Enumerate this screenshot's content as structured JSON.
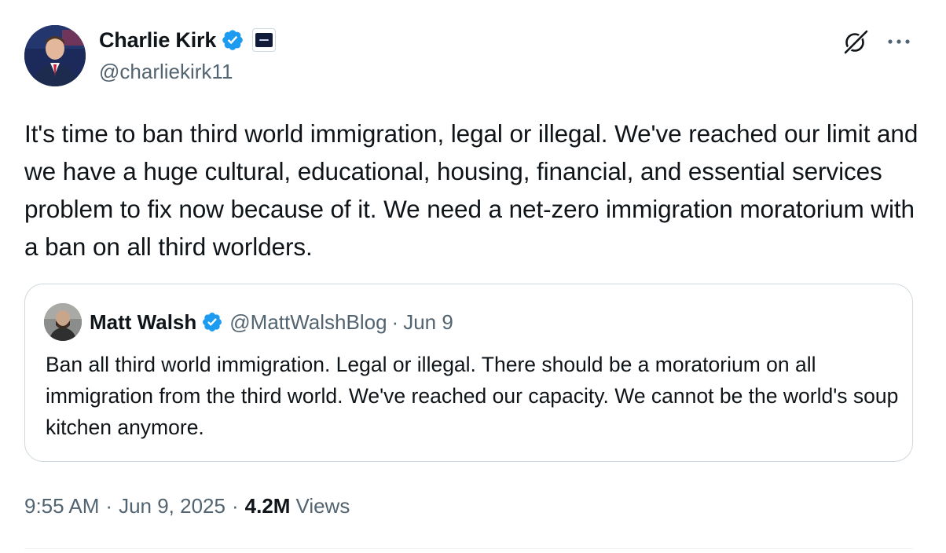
{
  "author": {
    "name": "Charlie Kirk",
    "handle": "@charliekirk11",
    "verified": true,
    "affiliate_badge": "organization-badge-icon"
  },
  "tweet": {
    "text": "It's time to ban third world immigration, legal or illegal. We've reached our limit and we have a huge cultural, educational, housing, financial, and essential services problem to fix now because of it. We need a net-zero immigration moratorium with a ban on all third worlders."
  },
  "quoted": {
    "name": "Matt Walsh",
    "handle": "@MattWalshBlog",
    "separator": "·",
    "date": "Jun 9",
    "verified": true,
    "text": "Ban all third world immigration. Legal or illegal. There should be a moratorium on all immigration from the third world. We've reached our capacity. We cannot be the world's soup kitchen anymore."
  },
  "meta": {
    "time": "9:55 AM",
    "separator": "·",
    "date": "Jun 9, 2025",
    "views_count": "4.2M",
    "views_label": "Views"
  },
  "icons": {
    "verified": "verified-badge-icon",
    "grok": "grok-icon",
    "more": "more-icon"
  },
  "colors": {
    "verified_blue": "#1d9bf0",
    "text_primary": "#0f1419",
    "text_secondary": "#536471",
    "border": "#cfd9de"
  }
}
